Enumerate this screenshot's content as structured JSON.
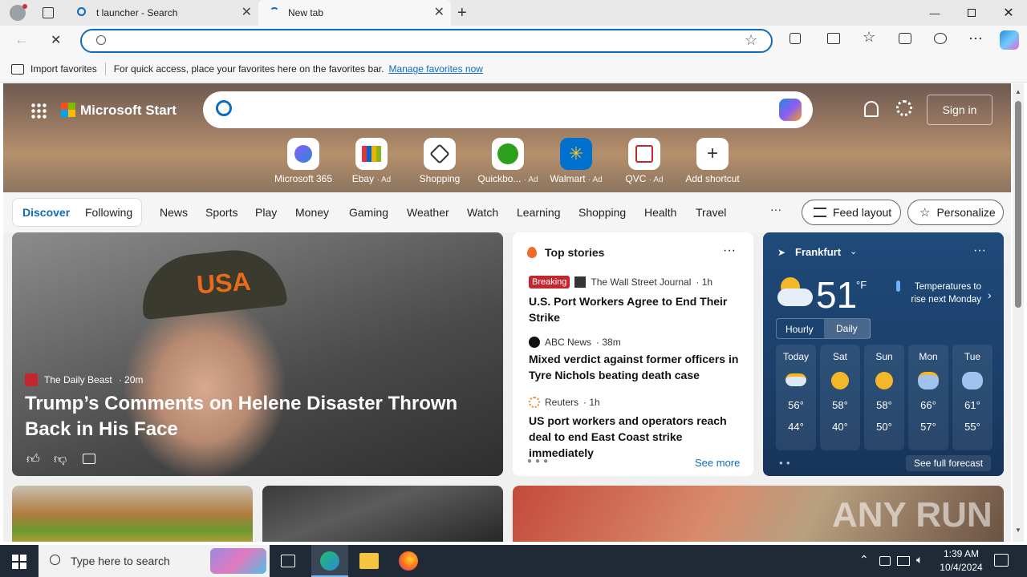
{
  "browser": {
    "tabs": [
      {
        "label": "t launcher - Search"
      },
      {
        "label": "New tab"
      }
    ],
    "address_value": "",
    "favbar": {
      "import": "Import favorites",
      "hint": "For quick access, place your favorites here on the favorites bar.",
      "manage": "Manage favorites now"
    }
  },
  "msn": {
    "brand": "Microsoft Start",
    "signin": "Sign in",
    "quicklinks": [
      {
        "label": "Microsoft 365",
        "ad": ""
      },
      {
        "label": "Ebay",
        "ad": "· Ad"
      },
      {
        "label": "Shopping",
        "ad": ""
      },
      {
        "label": "Quickbo...",
        "ad": "· Ad"
      },
      {
        "label": "Walmart",
        "ad": "· Ad"
      },
      {
        "label": "QVC",
        "ad": "· Ad"
      },
      {
        "label": "Add shortcut",
        "ad": ""
      }
    ],
    "nav": {
      "discover": "Discover",
      "following": "Following",
      "items": [
        "News",
        "Sports",
        "Play",
        "Money",
        "Gaming",
        "Weather",
        "Watch",
        "Learning",
        "Shopping",
        "Health",
        "Travel"
      ],
      "more": "···",
      "feed_layout": "Feed layout",
      "personalize": "Personalize"
    },
    "hero_story": {
      "source": "The Daily Beast",
      "time": "· 20m",
      "title": "Trump’s Comments on Helene Disaster Thrown Back in His Face",
      "cap_text": "USA"
    },
    "top_stories": {
      "title": "Top stories",
      "items": [
        {
          "badge": "Breaking",
          "source": "The Wall Street Journal",
          "time": "· 1h",
          "headline": "U.S. Port Workers Agree to End Their Strike"
        },
        {
          "badge": "",
          "source": "ABC News",
          "time": "· 38m",
          "headline": "Mixed verdict against former officers in Tyre Nichols beating death case"
        },
        {
          "badge": "",
          "source": "Reuters",
          "time": "· 1h",
          "headline": "US port workers and operators reach deal to end East Coast strike immediately"
        }
      ],
      "see_more": "See more"
    },
    "weather": {
      "city": "Frankfurt",
      "temp": "51",
      "unit": "°F",
      "note": "Temperatures to rise next Monday",
      "tab_hourly": "Hourly",
      "tab_daily": "Daily",
      "days": [
        {
          "day": "Today",
          "hi": "56°",
          "lo": "44°"
        },
        {
          "day": "Sat",
          "hi": "58°",
          "lo": "40°"
        },
        {
          "day": "Sun",
          "hi": "58°",
          "lo": "50°"
        },
        {
          "day": "Mon",
          "hi": "66°",
          "lo": "57°"
        },
        {
          "day": "Tue",
          "hi": "61°",
          "lo": "55°"
        }
      ],
      "see_full": "See full forecast"
    },
    "watermark": "ANY RUN"
  },
  "taskbar": {
    "search_placeholder": "Type here to search",
    "time": "1:39 AM",
    "date": "10/4/2024"
  }
}
